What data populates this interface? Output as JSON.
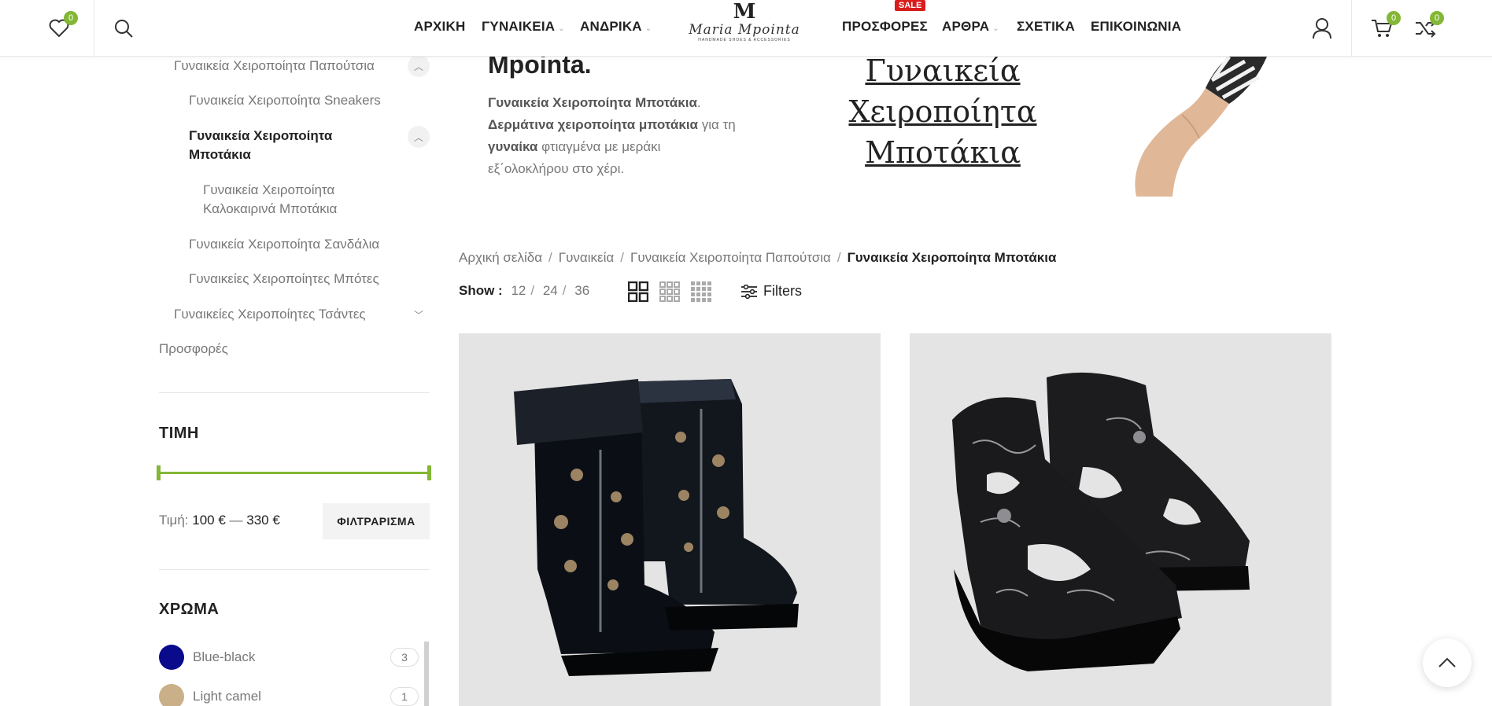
{
  "header": {
    "wishlist_count": "0",
    "cart_count": "0",
    "compare_count": "0",
    "nav_left": [
      "ΑΡΧΙΚΗ",
      "ΓΥΝΑΙΚΕΙΑ",
      "ΑΝΔΡΙΚΑ"
    ],
    "nav_right": [
      "ΠΡΟΣΦΟΡΕΣ",
      "ΑΡΘΡΑ",
      "ΣΧΕΤΙΚΑ",
      "ΕΠΙΚΟΙΝΩΝΙΑ"
    ],
    "sale_label": "SALE",
    "logo": {
      "mark": "M",
      "name": "Maria Mpointa",
      "tagline": "HANDMADE SHOES & ACCESSORIES"
    }
  },
  "sidebar": {
    "categories": {
      "shoes": "Γυναικεία Χειροποίητα Παπούτσια",
      "sneakers": "Γυναικεία Χειροποίητα Sneakers",
      "boots_line1": "Γυναικεία Χειροποίητα",
      "boots_line2": "Μποτάκια",
      "summer_line1": "Γυναικεία Χειροποίητα",
      "summer_line2": "Καλοκαιρινά Μποτάκια",
      "sandals": "Γυναικεία Χειροποίητα Σανδάλια",
      "tall_boots": "Γυναικείες Χειροποίητες Μπότες",
      "bags": "Γυναικείες Χειροποίητες Τσάντες",
      "offers": "Προσφορές"
    },
    "price": {
      "title": "ΤΙΜΗ",
      "label": "Τιμή:",
      "min": "100 €",
      "dash": "—",
      "max": "330 €",
      "min_fraction": 0,
      "max_fraction": 1,
      "button": "ΦΙΛΤΡΑΡΙΣΜΑ"
    },
    "color": {
      "title": "ΧΡΩΜΑ",
      "items": [
        {
          "name": "Blue-black",
          "count": "3",
          "swatch": "#0a0a8c"
        },
        {
          "name": "Light camel",
          "count": "1",
          "swatch": "#c9b088"
        }
      ]
    }
  },
  "hero": {
    "title": "Mpointa.",
    "desc": {
      "b1": "Γυναικεία Χειροποίητα Μποτάκια",
      "t1": ".",
      "b2": "Δερμάτινα χειροποίητα μποτάκια",
      "t2": " για τη ",
      "b3": "γυναίκα",
      "t3": " φτιαγμένα με μεράκι εξ΄ολοκλήρου στο χέρι."
    },
    "big_line1": "Γυναικεία",
    "big_line2": "Χειροποίητα",
    "big_line3": "Μποτάκια"
  },
  "breadcrumb": {
    "items": [
      "Αρχική σελίδα",
      "Γυναικεία",
      "Γυναικεία Χειροποίητα Παπούτσια"
    ],
    "current": "Γυναικεία Χειροποίητα Μποτάκια",
    "separator": "/"
  },
  "toolbar": {
    "show_label": "Show :",
    "options": [
      "12",
      "24",
      "36"
    ],
    "filters_label": "Filters"
  },
  "colors": {
    "accent": "#83b735",
    "sale": "#d91c1c",
    "text": "#222222",
    "muted": "#777777"
  }
}
